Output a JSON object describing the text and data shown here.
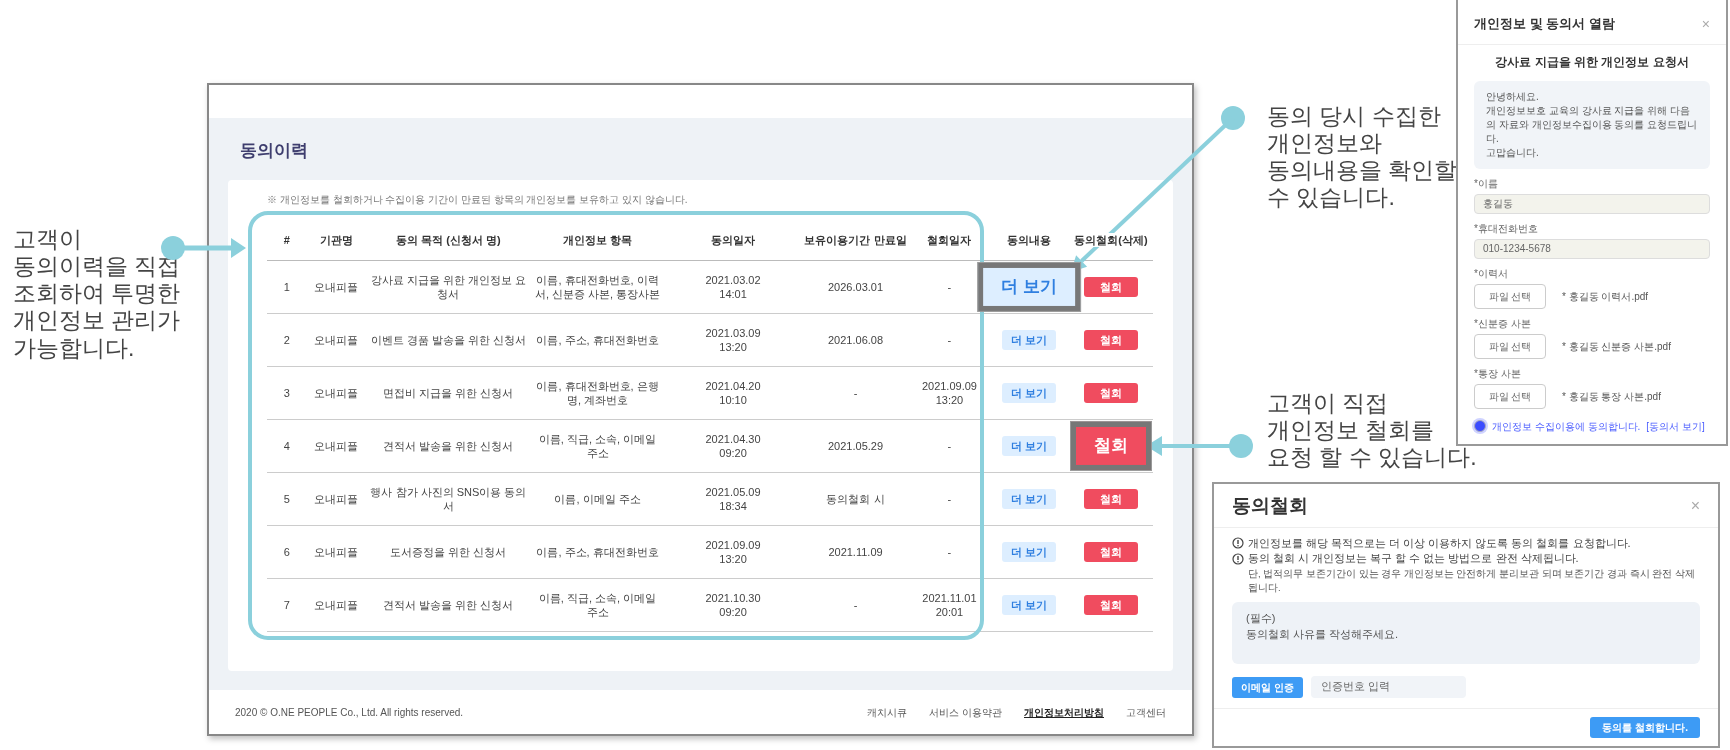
{
  "callouts": [
    {
      "text": "고객이\n동의이력을 직접\n조회하여 투명한\n개인정보 관리가\n가능합니다."
    },
    {
      "text": "동의 당시 수집한\n개인정보와\n동의내용을 확인할\n수 있습니다."
    },
    {
      "text": "고객이 직접\n개인정보 철회를\n요청 할 수 있습니다."
    }
  ],
  "consent_history": {
    "title": "동의이력",
    "notice": "※ 개인정보를 철회하거나 수집이용 기간이 만료된 항목의 개인정보를 보유하고 있지 않습니다.",
    "columns": [
      "#",
      "기관명",
      "동의 목적 (신청서 명)",
      "개인정보 항목",
      "동의일자",
      "보유이용기간 만료일",
      "철회일자",
      "동의내용",
      "동의철회(삭제)"
    ],
    "rows": [
      {
        "no": "1",
        "org": "오내피플",
        "purpose": "강사료 지급을 위한 개인정보 요청서",
        "items": "이름, 휴대전화번호, 이력서, 신분증 사본, 통장사본",
        "consent_date": "2021.03.02\n14:01",
        "expiry": "2026.03.01",
        "withdrawn": "-",
        "detail_button": {
          "label": "더 보기",
          "highlighted": true
        },
        "withdraw_button": {
          "label": "철회",
          "highlighted": false
        }
      },
      {
        "no": "2",
        "org": "오내피플",
        "purpose": "이벤트 경품 발송을 위한 신청서",
        "items": "이름, 주소, 휴대전화번호",
        "consent_date": "2021.03.09\n13:20",
        "expiry": "2021.06.08",
        "withdrawn": "-",
        "detail_button": {
          "label": "더 보기",
          "highlighted": false
        },
        "withdraw_button": {
          "label": "철회",
          "highlighted": false
        }
      },
      {
        "no": "3",
        "org": "오내피플",
        "purpose": "면접비 지급을 위한 신청서",
        "items": "이름, 휴대전화번호, 은행명, 계좌번호",
        "consent_date": "2021.04.20\n10:10",
        "expiry": "-",
        "withdrawn": "2021.09.09\n13:20",
        "detail_button": {
          "label": "더 보기",
          "highlighted": false
        },
        "withdraw_button": {
          "label": "철회",
          "highlighted": false
        }
      },
      {
        "no": "4",
        "org": "오내피플",
        "purpose": "견적서 발송을 위한 신청서",
        "items": "이름, 직급, 소속, 이메일 주소",
        "consent_date": "2021.04.30\n09:20",
        "expiry": "2021.05.29",
        "withdrawn": "-",
        "detail_button": {
          "label": "더 보기",
          "highlighted": false
        },
        "withdraw_button": {
          "label": "철회",
          "highlighted": true
        }
      },
      {
        "no": "5",
        "org": "오내피플",
        "purpose": "행사 참가 사진의 SNS이용 동의서",
        "items": "이름, 이메일 주소",
        "consent_date": "2021.05.09\n18:34",
        "expiry": "동의철회 시",
        "withdrawn": "-",
        "detail_button": {
          "label": "더 보기",
          "highlighted": false
        },
        "withdraw_button": {
          "label": "철회",
          "highlighted": false
        }
      },
      {
        "no": "6",
        "org": "오내피플",
        "purpose": "도서증정을 위한 신청서",
        "items": "이름, 주소, 휴대전화번호",
        "consent_date": "2021.09.09\n13:20",
        "expiry": "2021.11.09",
        "withdrawn": "-",
        "detail_button": {
          "label": "더 보기",
          "highlighted": false
        },
        "withdraw_button": {
          "label": "철회",
          "highlighted": false
        }
      },
      {
        "no": "7",
        "org": "오내피플",
        "purpose": "견적서 발송을 위한 신청서",
        "items": "이름, 직급, 소속, 이메일 주소",
        "consent_date": "2021.10.30\n09:20",
        "expiry": "-",
        "withdrawn": "2021.11.01\n20:01",
        "detail_button": {
          "label": "더 보기",
          "highlighted": false
        },
        "withdraw_button": {
          "label": "철회",
          "highlighted": false
        }
      }
    ],
    "footer": {
      "copyright": "2020 © O.NE PEOPLE Co., Ltd. All rights reserved.",
      "links": [
        {
          "label": "캐치시큐",
          "selected": false
        },
        {
          "label": "서비스 이용약관",
          "selected": false
        },
        {
          "label": "개인정보처리방침",
          "selected": true
        },
        {
          "label": "고객센터",
          "selected": false
        }
      ]
    }
  },
  "view_modal": {
    "title": "개인정보 및 동의서 열람",
    "close": "×",
    "form_title": "강사료 지급을 위한 개인정보 요청서",
    "message": "안녕하세요.\n개인정보보호 교육의 강사료 지급을 위해 다음의 자료와 개인정보수집이용 동의를 요청드립니다.\n고맙습니다.",
    "fields": [
      {
        "kind": "text",
        "label": "*이름",
        "value": "홍길동"
      },
      {
        "kind": "text",
        "label": "*휴대전화번호",
        "value": "010-1234-5678"
      },
      {
        "kind": "file",
        "label": "*이력서",
        "button": "파일 선택",
        "file": "* 홍길동 이력서.pdf"
      },
      {
        "kind": "file",
        "label": "*신분증 사본",
        "button": "파일 선택",
        "file": "* 홍길동 신분증 사본.pdf"
      },
      {
        "kind": "file",
        "label": "*통장 사본",
        "button": "파일 선택",
        "file": "* 홍길동 통장 사본.pdf"
      }
    ],
    "consent": {
      "checked": true,
      "text": "개인정보 수집이용에 동의합니다.",
      "link": "[동의서 보기]"
    }
  },
  "withdraw_modal": {
    "title": "동의철회",
    "close": "×",
    "notices": [
      {
        "kind": "warning",
        "text": "개인정보를 해당 목적으로는 더 이상 이용하지 않도록 동의 철회를 요청합니다."
      },
      {
        "kind": "warning",
        "text": "동의 철회 시 개인정보는 복구 할 수 없는 방법으로 완전 삭제됩니다."
      },
      {
        "kind": "note",
        "text": "단, 법적의무 보존기간이 있는 경우 개인정보는 안전하게 분리보관 되며 보존기간 경과 즉시 완전 삭제됩니다."
      }
    ],
    "reason": {
      "placeholder": "(필수)\n동의철회 사유를 작성해주세요."
    },
    "verify_button": "이메일 인증",
    "code": {
      "placeholder": "인증번호 입력"
    },
    "submit": "동의를 철회합니다."
  }
}
